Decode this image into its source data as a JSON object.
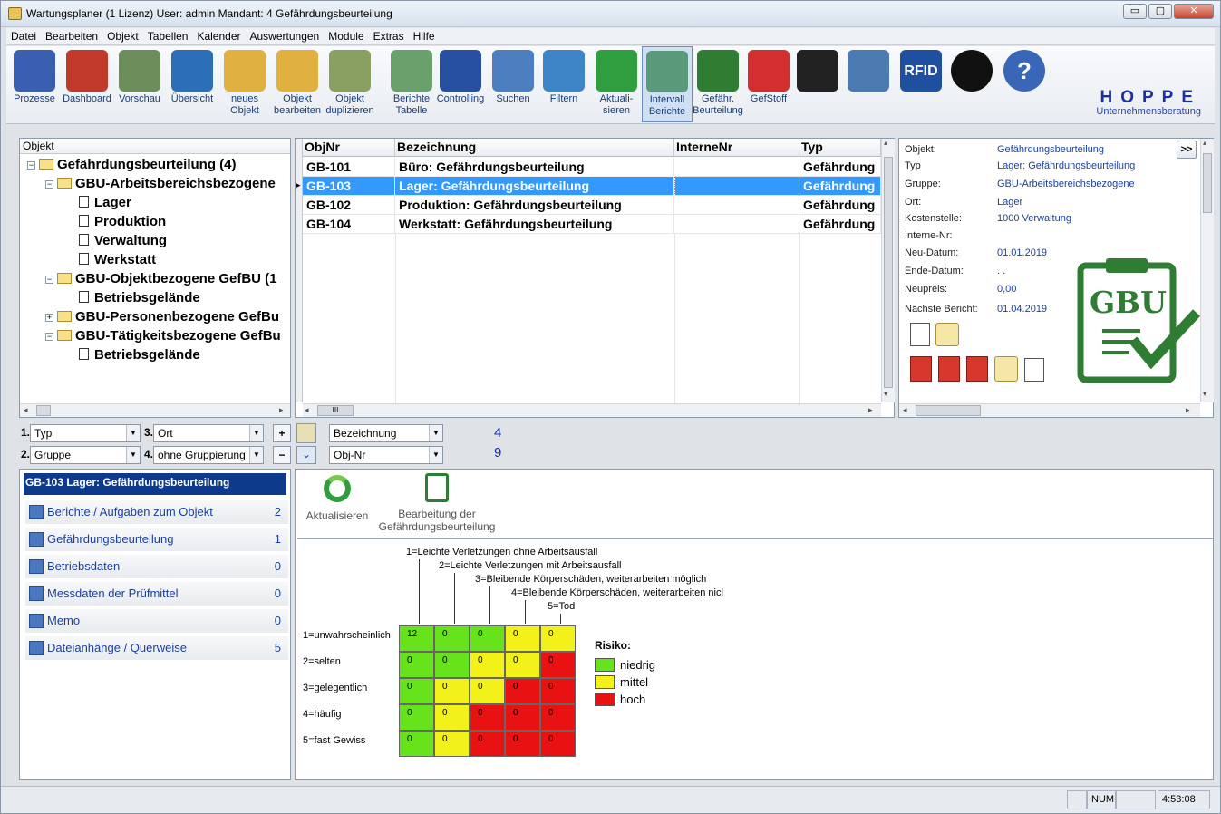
{
  "window": {
    "title": "Wartungsplaner  (1 Lizenz)   User: admin Mandant: 4 Gefährdungsbeurteilung",
    "min": "▭",
    "max": "▢",
    "close": "✕"
  },
  "menu": [
    "Datei",
    "Bearbeiten",
    "Objekt",
    "Tabellen",
    "Kalender",
    "Auswertungen",
    "Module",
    "Extras",
    "Hilfe"
  ],
  "toolbar": [
    {
      "l1": "Prozesse",
      "l2": "",
      "icon": "process-icon",
      "color": "#3a5fb0"
    },
    {
      "l1": "Dashboard",
      "l2": "",
      "icon": "dashboard-icon",
      "color": "#c0392b"
    },
    {
      "l1": "Vorschau",
      "l2": "",
      "icon": "preview-clock-icon",
      "color": "#6b8e5a"
    },
    {
      "l1": "Übersicht",
      "l2": "",
      "icon": "overview-icon",
      "color": "#2c6fb8"
    },
    {
      "l1": "neues",
      "l2": "Objekt",
      "icon": "new-object-icon",
      "color": "#e0b040"
    },
    {
      "l1": "Objekt",
      "l2": "bearbeiten",
      "icon": "edit-object-icon",
      "color": "#e0b040"
    },
    {
      "l1": "Objekt",
      "l2": "duplizieren",
      "icon": "duplicate-object-icon",
      "color": "#8aa060"
    },
    {
      "l1": "Berichte",
      "l2": "Tabelle",
      "icon": "report-table-icon",
      "color": "#6aa06a"
    },
    {
      "l1": "Controlling",
      "l2": "",
      "icon": "controlling-chart-icon",
      "color": "#2850a0"
    },
    {
      "l1": "Suchen",
      "l2": "",
      "icon": "search-icon",
      "color": "#4d7fc0"
    },
    {
      "l1": "Filtern",
      "l2": "",
      "icon": "filter-icon",
      "color": "#3d85c6"
    },
    {
      "l1": "Aktuali-",
      "l2": "sieren",
      "icon": "refresh-icon",
      "color": "#2e9e3e"
    },
    {
      "l1": "Intervall",
      "l2": "Berichte",
      "icon": "interval-report-icon",
      "color": "#5a9a7a"
    },
    {
      "l1": "Gefähr.",
      "l2": "Beurteilung",
      "icon": "gbu-icon",
      "color": "#2e7d32"
    },
    {
      "l1": "GefStoff",
      "l2": "",
      "icon": "hazard-icon",
      "color": "#d32f2f"
    },
    {
      "l1": "",
      "l2": "",
      "icon": "mobile-phone-icon",
      "color": "#222"
    },
    {
      "l1": "",
      "l2": "",
      "icon": "handheld-scanner-icon",
      "color": "#4a7ab0"
    },
    {
      "l1": "",
      "l2": "",
      "icon": "rfid-icon",
      "color": "#1f4fa0"
    },
    {
      "l1": "",
      "l2": "",
      "icon": "camera-icon",
      "color": "#111"
    },
    {
      "l1": "",
      "l2": "",
      "icon": "help-icon",
      "color": "#3a66b8"
    }
  ],
  "rfid_label": "RFID",
  "help_label": "?",
  "gbu_label": "GBU",
  "brand": {
    "name": "HOPPE",
    "sub": "Unternehmensberatung"
  },
  "tree": {
    "header": "Objekt",
    "nodes": [
      {
        "label": "Gefährdungsbeurteilung  (4)",
        "kind": "folder",
        "exp": "−"
      },
      {
        "label": "GBU-Arbeitsbereichsbezogene",
        "kind": "folder",
        "exp": "−"
      },
      {
        "label": "Lager",
        "kind": "doc",
        "exp": ""
      },
      {
        "label": "Produktion",
        "kind": "doc",
        "exp": ""
      },
      {
        "label": "Verwaltung",
        "kind": "doc",
        "exp": ""
      },
      {
        "label": "Werkstatt",
        "kind": "doc",
        "exp": ""
      },
      {
        "label": "GBU-Objektbezogene GefBU  (1",
        "kind": "folder",
        "exp": "−"
      },
      {
        "label": "Betriebsgelände",
        "kind": "doc",
        "exp": ""
      },
      {
        "label": "GBU-Personenbezogene GefBu",
        "kind": "folder",
        "exp": "+"
      },
      {
        "label": "GBU-Tätigkeitsbezogene GefBu",
        "kind": "folder",
        "exp": "−"
      },
      {
        "label": "Betriebsgelände",
        "kind": "doc",
        "exp": ""
      }
    ]
  },
  "grid": {
    "columns": [
      "ObjNr",
      "Bezeichnung",
      "InterneNr",
      "Typ"
    ],
    "rows": [
      {
        "nr": "GB-101",
        "bez": "Büro: Gefährdungsbeurteilung",
        "int": "",
        "typ": "Gefährdung"
      },
      {
        "nr": "GB-103",
        "bez": "Lager: Gefährdungsbeurteilung",
        "int": "",
        "typ": "Gefährdung"
      },
      {
        "nr": "GB-102",
        "bez": "Produktion: Gefährdungsbeurteilung",
        "int": "",
        "typ": "Gefährdung"
      },
      {
        "nr": "GB-104",
        "bez": "Werkstatt: Gefährdungsbeurteilung",
        "int": "",
        "typ": "Gefährdung"
      }
    ],
    "scroll_h": "III"
  },
  "info": {
    "expand": ">>",
    "fields": [
      {
        "l": "Objekt:",
        "v": "Gefährdungsbeurteilung"
      },
      {
        "l": "Typ",
        "v": "Lager: Gefährdungsbeurteilung"
      },
      {
        "l": "Gruppe:",
        "v": "GBU-Arbeitsbereichsbezogene"
      },
      {
        "l": "Ort:",
        "v": "Lager"
      },
      {
        "l": "Kostenstelle:",
        "v": "1000 Verwaltung"
      },
      {
        "l": "Interne-Nr:",
        "v": ""
      },
      {
        "l": "Neu-Datum:",
        "v": "01.01.2019"
      },
      {
        "l": "Ende-Datum:",
        "v": " .  ."
      },
      {
        "l": "Neupreis:",
        "v": "0,00"
      },
      {
        "l": "Nächste Bericht:",
        "v": "01.04.2019"
      }
    ]
  },
  "filters": {
    "n1": "1.",
    "n2": "2.",
    "n3": "3.",
    "n4": "4.",
    "f1": "Typ",
    "f2": "Gruppe",
    "f3": "Ort",
    "f4": "ohne Gruppierung",
    "s1": "Bezeichnung",
    "s2": "Obj-Nr",
    "c1": "4",
    "c2": "9",
    "plus": "+",
    "minus": "−",
    "down": "⌄"
  },
  "nav": {
    "title": "GB-103 Lager: Gefährdungsbeurteilung",
    "items": [
      {
        "label": "Berichte / Aufgaben zum Objekt",
        "count": "2"
      },
      {
        "label": "Gefährdungsbeurteilung",
        "count": "1"
      },
      {
        "label": "Betriebsdaten",
        "count": "0"
      },
      {
        "label": "Messdaten der Prüfmittel",
        "count": "0"
      },
      {
        "label": "Memo",
        "count": "0"
      },
      {
        "label": "Dateianhänge / Querweise",
        "count": "5"
      }
    ]
  },
  "detail": {
    "refresh": "Aktualisieren",
    "edit1": "Bearbeitung der",
    "edit2": "Gefährdungsbeurteilung"
  },
  "matrix": {
    "severity": [
      "1=Leichte Verletzungen ohne Arbeitsausfall",
      "2=Leichte Verletzungen mit Arbeitsausfall",
      "3=Bleibende Körperschäden, weiterarbeiten möglich",
      "4=Bleibende Körperschäden, weiterarbeiten nicl",
      "5=Tod"
    ],
    "likelihood": [
      "1=unwahrscheinlich",
      "2=selten",
      "3=gelegentlich",
      "4=häufig",
      "5=fast Gewiss"
    ],
    "values": [
      [
        "12",
        "0",
        "0",
        "0",
        "0"
      ],
      [
        "0",
        "0",
        "0",
        "0",
        "0"
      ],
      [
        "0",
        "0",
        "0",
        "0",
        "0"
      ],
      [
        "0",
        "0",
        "0",
        "0",
        "0"
      ],
      [
        "0",
        "0",
        "0",
        "0",
        "0"
      ]
    ],
    "levels": [
      [
        "g",
        "g",
        "g",
        "y",
        "y"
      ],
      [
        "g",
        "g",
        "y",
        "y",
        "r"
      ],
      [
        "g",
        "y",
        "y",
        "r",
        "r"
      ],
      [
        "g",
        "y",
        "r",
        "r",
        "r"
      ],
      [
        "g",
        "y",
        "r",
        "r",
        "r"
      ]
    ],
    "colors": {
      "g": "#66e31a",
      "y": "#f2f21a",
      "r": "#e81212"
    },
    "legend_title": "Risiko:",
    "legend": [
      {
        "k": "g",
        "label": "niedrig"
      },
      {
        "k": "y",
        "label": "mittel"
      },
      {
        "k": "r",
        "label": "hoch"
      }
    ]
  },
  "status": {
    "num": "NUM",
    "time": "4:53:08"
  }
}
